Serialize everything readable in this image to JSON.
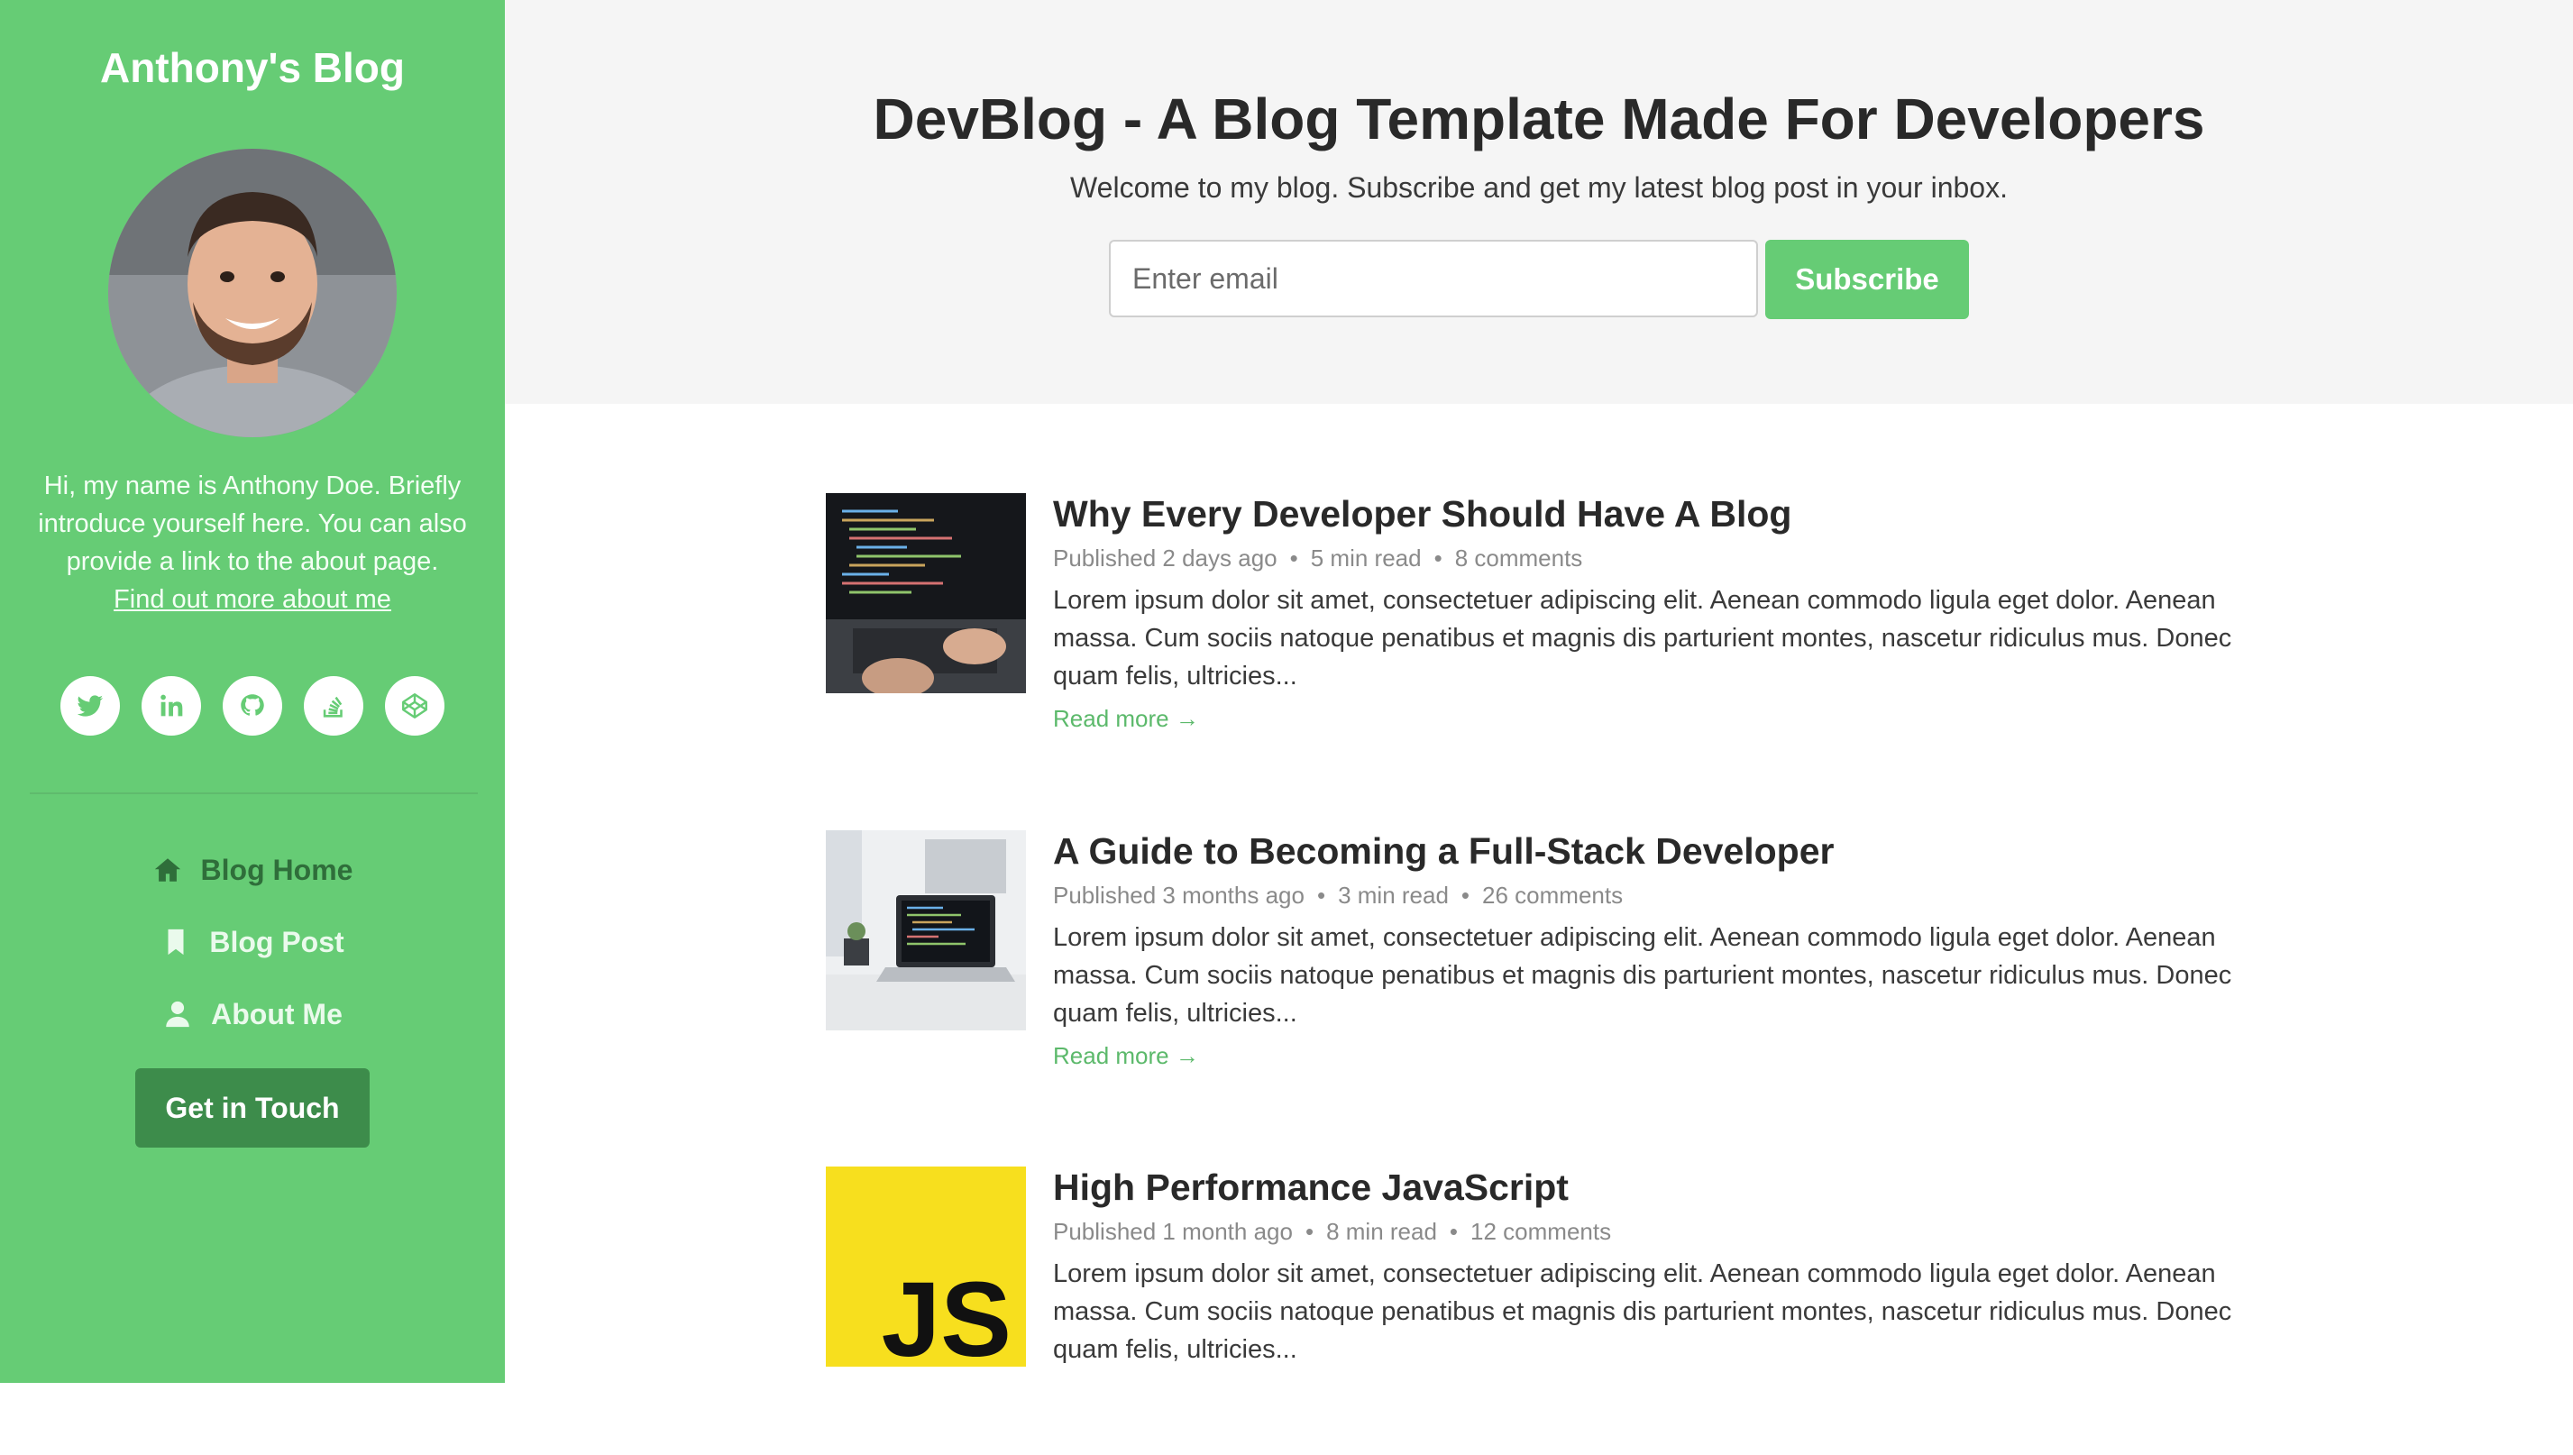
{
  "sidebar": {
    "blog_name": "Anthony's Blog",
    "bio": "Hi, my name is Anthony Doe. Briefly introduce yourself here. You can also provide a link to the about page.",
    "bio_link": "Find out more about me",
    "social": [
      {
        "icon": "twitter-icon"
      },
      {
        "icon": "linkedin-icon"
      },
      {
        "icon": "github-icon"
      },
      {
        "icon": "stack-overflow-icon"
      },
      {
        "icon": "codepen-icon"
      }
    ],
    "nav": [
      {
        "label": "Blog Home",
        "icon": "home-icon",
        "active": true
      },
      {
        "label": "Blog Post",
        "icon": "bookmark-icon",
        "active": false
      },
      {
        "label": "About Me",
        "icon": "user-icon",
        "active": false
      }
    ],
    "cta": "Get in Touch"
  },
  "header": {
    "title": "DevBlog - A Blog Template Made For Developers",
    "intro": "Welcome to my blog. Subscribe and get my latest blog post in your inbox.",
    "email_placeholder": "Enter email",
    "subscribe_label": "Subscribe"
  },
  "posts": [
    {
      "title": "Why Every Developer Should Have A Blog",
      "published": "Published 2 days ago",
      "read_time": "5 min read",
      "comments": "8 comments",
      "excerpt": "Lorem ipsum dolor sit amet, consectetuer adipiscing elit. Aenean commodo ligula eget dolor. Aenean massa. Cum sociis natoque penatibus et magnis dis parturient montes, nascetur ridiculus mus. Donec quam felis, ultricies...",
      "read_more": "Read more →"
    },
    {
      "title": "A Guide to Becoming a Full-Stack Developer",
      "published": "Published 3 months ago",
      "read_time": "3 min read",
      "comments": "26 comments",
      "excerpt": "Lorem ipsum dolor sit amet, consectetuer adipiscing elit. Aenean commodo ligula eget dolor. Aenean massa. Cum sociis natoque penatibus et magnis dis parturient montes, nascetur ridiculus mus. Donec quam felis, ultricies...",
      "read_more": "Read more →"
    },
    {
      "title": "High Performance JavaScript",
      "published": "Published 1 month ago",
      "read_time": "8 min read",
      "comments": "12 comments",
      "excerpt": "Lorem ipsum dolor sit amet, consectetuer adipiscing elit. Aenean commodo ligula eget dolor. Aenean massa. Cum sociis natoque penatibus et magnis dis parturient montes, nascetur ridiculus mus. Donec quam felis, ultricies...",
      "thumb_text": "JS"
    }
  ],
  "colors": {
    "accent": "#66cc75",
    "accent_dark": "#3d8c4b",
    "js_yellow": "#f7df1e"
  }
}
